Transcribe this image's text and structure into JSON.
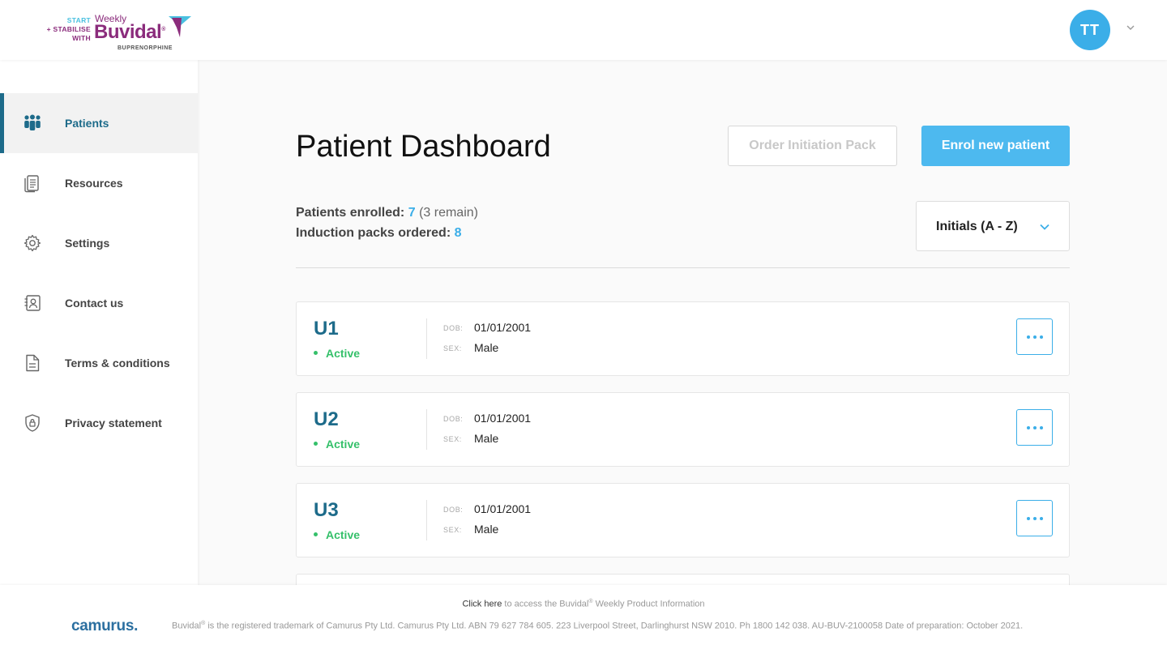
{
  "brand": {
    "start": "START",
    "plus_stabilise": "+ STABILISE",
    "with": "WITH",
    "weekly": "Weekly",
    "name": "Buvidal",
    "reg": "®",
    "sub": "BUPRENORPHINE"
  },
  "user": {
    "initials": "TT"
  },
  "sidebar": {
    "items": [
      {
        "label": "Patients",
        "icon": "patients-icon",
        "active": true
      },
      {
        "label": "Resources",
        "icon": "resources-icon"
      },
      {
        "label": "Settings",
        "icon": "gear-icon"
      },
      {
        "label": "Contact us",
        "icon": "contact-icon"
      },
      {
        "label": "Terms & conditions",
        "icon": "document-icon"
      },
      {
        "label": "Privacy statement",
        "icon": "shield-lock-icon"
      }
    ]
  },
  "main": {
    "title": "Patient Dashboard",
    "order_button": "Order Initiation Pack",
    "enrol_button": "Enrol new patient",
    "stats": {
      "enrolled_label": "Patients enrolled:",
      "enrolled_value": "7",
      "remain": "(3 remain)",
      "packs_label": "Induction packs ordered:",
      "packs_value": "8"
    },
    "sort": {
      "selected": "Initials (A - Z)"
    },
    "patients": [
      {
        "id": "U1",
        "status": "Active",
        "dob_label": "DOB:",
        "dob": "01/01/2001",
        "sex_label": "SEX:",
        "sex": "Male"
      },
      {
        "id": "U2",
        "status": "Active",
        "dob_label": "DOB:",
        "dob": "01/01/2001",
        "sex_label": "SEX:",
        "sex": "Male"
      },
      {
        "id": "U3",
        "status": "Active",
        "dob_label": "DOB:",
        "dob": "01/01/2001",
        "sex_label": "SEX:",
        "sex": "Male"
      }
    ]
  },
  "footer": {
    "click_here": "Click here",
    "link_rest": "to access the Buvidal",
    "link_reg": "®",
    "link_end": "Weekly Product Information",
    "company": "camurus.",
    "legal_brand": "Buvidal",
    "legal_reg": "®",
    "legal_text": "is the registered trademark of Camurus Pty Ltd. Camurus Pty Ltd. ABN 79 627 784 605. 223 Liverpool Street, Darlinghurst NSW 2010. Ph 1800 142 038. AU-BUV-2100058 Date of preparation: October 2021."
  },
  "colors": {
    "primary": "#1d6b8a",
    "accent": "#3baee8",
    "active": "#35c06a",
    "brand": "#8b2c7c"
  }
}
